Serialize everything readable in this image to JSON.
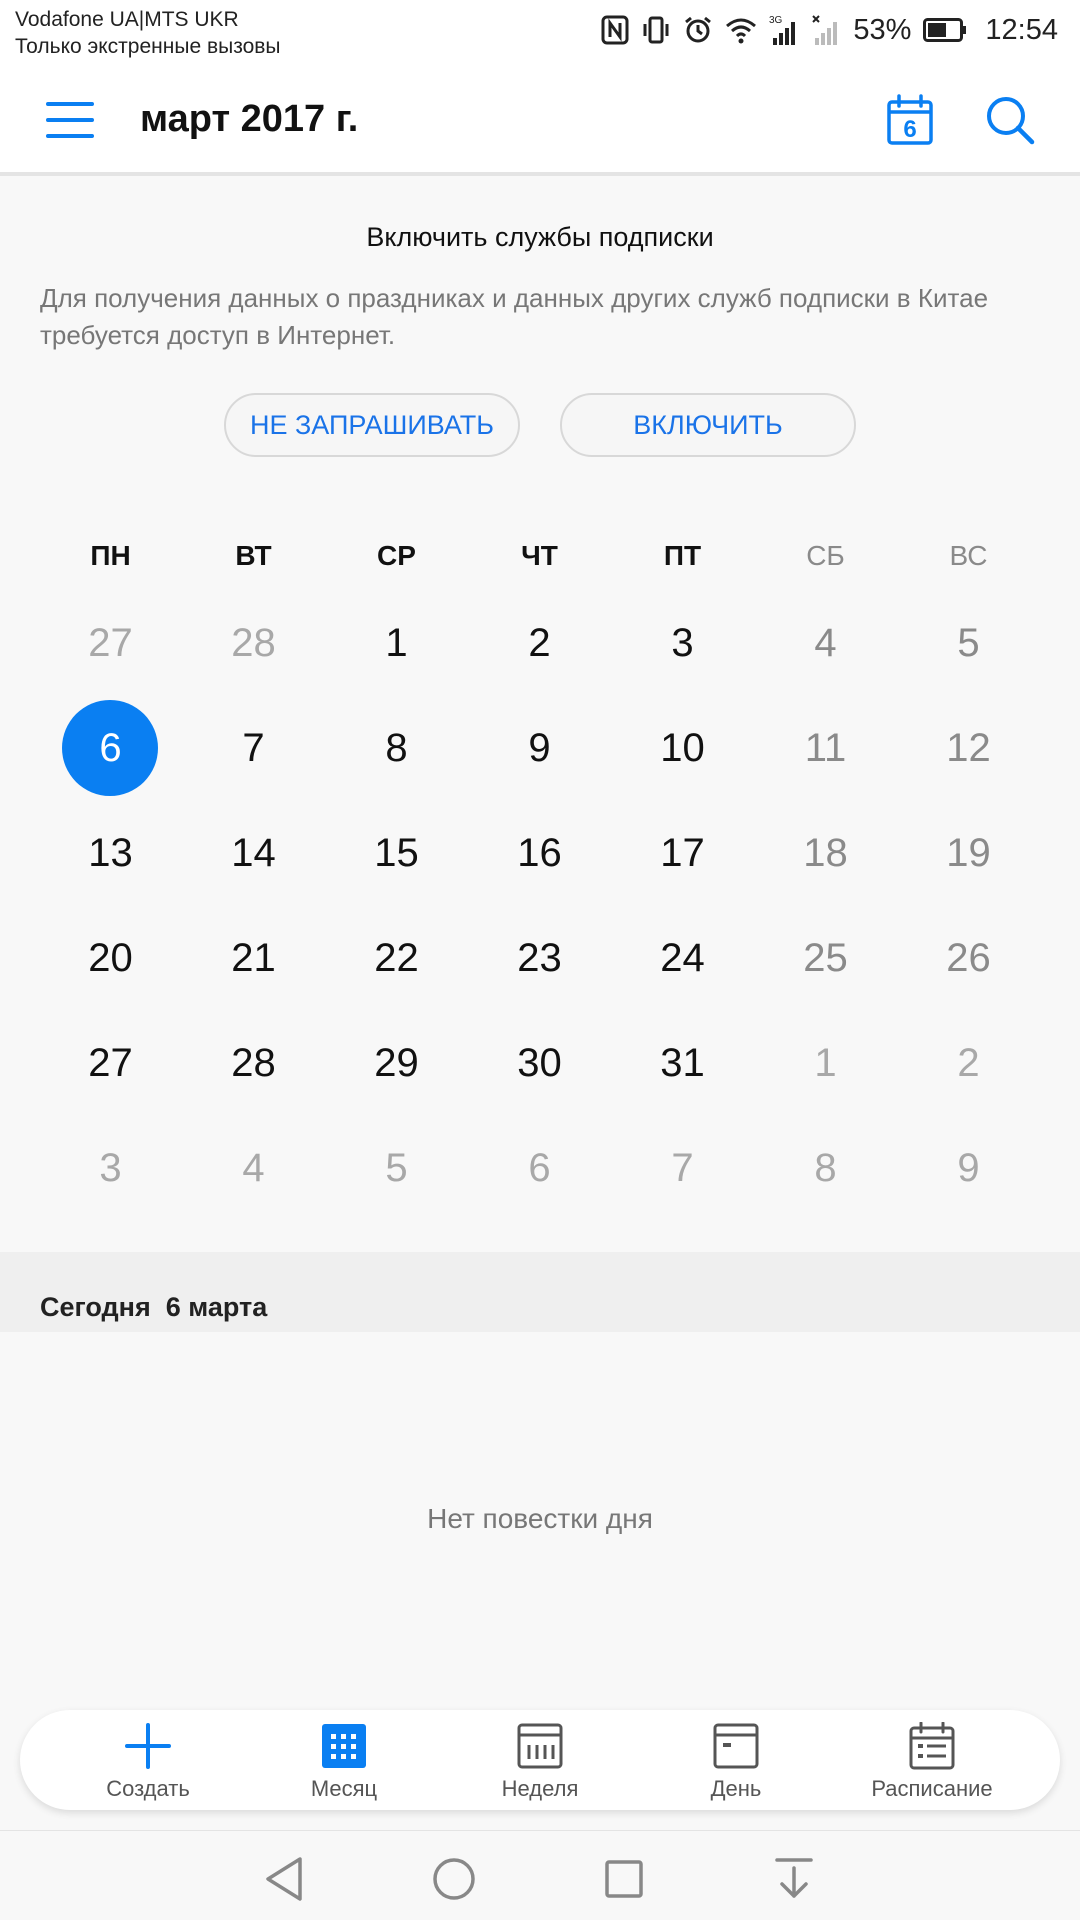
{
  "status_bar": {
    "carrier_1": "Vodafone UA|MTS UKR",
    "carrier_2": "Только экстренные вызовы",
    "battery": "53%",
    "time": "12:54",
    "icons": [
      "nfc-icon",
      "vibrate-icon",
      "alarm-icon",
      "wifi-icon",
      "signal-3g-icon",
      "signal-no-service-icon",
      "battery-icon"
    ]
  },
  "header": {
    "title": "март 2017 г.",
    "today_icon_day": "6"
  },
  "subscription": {
    "title": "Включить службы подписки",
    "description": "Для получения данных о праздниках и данных других служб подписки в Китае требуется доступ в Интернет.",
    "decline_label": "НЕ ЗАПРАШИВАТЬ",
    "enable_label": "ВКЛЮЧИТЬ"
  },
  "calendar": {
    "weekdays": [
      "ПН",
      "ВТ",
      "СР",
      "ЧТ",
      "ПТ",
      "СБ",
      "ВС"
    ],
    "weeks": [
      [
        "27",
        "28",
        "1",
        "2",
        "3",
        "4",
        "5"
      ],
      [
        "6",
        "7",
        "8",
        "9",
        "10",
        "11",
        "12"
      ],
      [
        "13",
        "14",
        "15",
        "16",
        "17",
        "18",
        "19"
      ],
      [
        "20",
        "21",
        "22",
        "23",
        "24",
        "25",
        "26"
      ],
      [
        "27",
        "28",
        "29",
        "30",
        "31",
        "1",
        "2"
      ],
      [
        "3",
        "4",
        "5",
        "6",
        "7",
        "8",
        "9"
      ]
    ],
    "selected_day": "6"
  },
  "agenda": {
    "today_label": "Сегодня  6 марта",
    "empty_text": "Нет повестки дня"
  },
  "tabs": [
    {
      "label": "Создать",
      "icon": "plus-icon"
    },
    {
      "label": "Месяц",
      "icon": "month-grid-icon"
    },
    {
      "label": "Неделя",
      "icon": "week-icon"
    },
    {
      "label": "День",
      "icon": "day-icon"
    },
    {
      "label": "Расписание",
      "icon": "schedule-icon"
    }
  ],
  "colors": {
    "accent": "#0a7ff2",
    "link": "#1a73e8",
    "muted": "#a8a8a8"
  }
}
